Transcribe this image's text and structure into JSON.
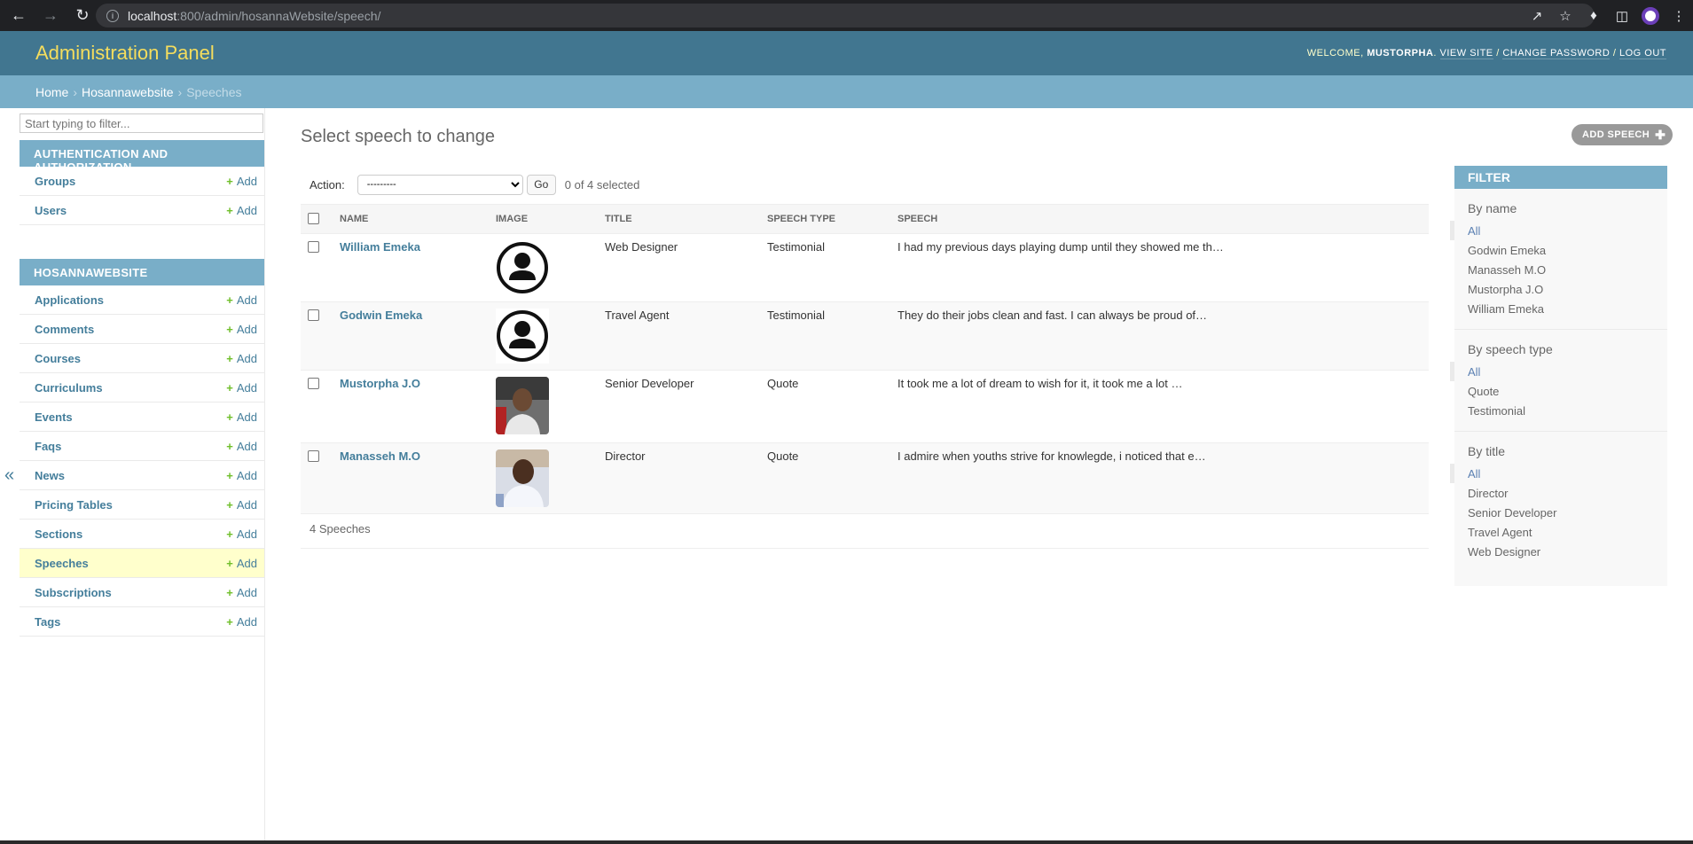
{
  "browser": {
    "url_host": "localhost",
    "url_rest": ":800/admin/hosannaWebsite/speech/"
  },
  "header": {
    "branding": "Administration Panel",
    "welcome": "Welcome,",
    "username": "Mustorpha",
    "view_site": "View site",
    "change_password": "Change password",
    "log_out": "Log out"
  },
  "breadcrumbs": {
    "home": "Home",
    "app": "Hosannawebsite",
    "current": "Speeches"
  },
  "sidebar": {
    "filter_placeholder": "Start typing to filter...",
    "add_label": "Add",
    "auth_caption": "Authentication and Authorization",
    "auth_items": [
      {
        "label": "Groups"
      },
      {
        "label": "Users"
      }
    ],
    "app_caption": "Hosannawebsite",
    "app_items": [
      {
        "label": "Applications"
      },
      {
        "label": "Comments"
      },
      {
        "label": "Courses"
      },
      {
        "label": "Curriculums"
      },
      {
        "label": "Events"
      },
      {
        "label": "Faqs"
      },
      {
        "label": "News"
      },
      {
        "label": "Pricing Tables"
      },
      {
        "label": "Sections"
      },
      {
        "label": "Speeches"
      },
      {
        "label": "Subscriptions"
      },
      {
        "label": "Tags"
      }
    ],
    "collapse_glyph": "«"
  },
  "content": {
    "title": "Select speech to change",
    "add_button": "Add Speech",
    "action_label": "Action:",
    "action_selected": "---------",
    "go": "Go",
    "counter": "0 of 4 selected",
    "columns": [
      "Name",
      "Image",
      "Title",
      "Speech type",
      "Speech"
    ],
    "rows": [
      {
        "name": "William Emeka",
        "image": "avatar-placeholder",
        "title": "Web Designer",
        "type": "Testimonial",
        "speech": "I had my previous days playing dump until they showed me th…"
      },
      {
        "name": "Godwin Emeka",
        "image": "avatar-placeholder",
        "title": "Travel Agent",
        "type": "Testimonial",
        "speech": "They do their jobs clean and fast. I can always be proud of…"
      },
      {
        "name": "Mustorpha J.O",
        "image": "photo",
        "title": "Senior Developer",
        "type": "Quote",
        "speech": "It took me a lot of dream to wish for it, it took me a lot …"
      },
      {
        "name": "Manasseh M.O",
        "image": "photo",
        "title": "Director",
        "type": "Quote",
        "speech": "I admire when youths strive for knowlegde, i noticed that e…"
      }
    ],
    "paginator": "4 Speeches"
  },
  "filter": {
    "title": "Filter",
    "groups": [
      {
        "heading": "By name",
        "options": [
          "All",
          "Godwin Emeka",
          "Manasseh M.O",
          "Mustorpha J.O",
          "William Emeka"
        ]
      },
      {
        "heading": "By speech type",
        "options": [
          "All",
          "Quote",
          "Testimonial"
        ]
      },
      {
        "heading": "By title",
        "options": [
          "All",
          "Director",
          "Senior Developer",
          "Travel Agent",
          "Web Designer"
        ]
      }
    ]
  },
  "colors": {
    "header": "#417690",
    "breadcrumb": "#79aec8",
    "branding": "#f5dd5d",
    "link": "#447e9b",
    "add_green": "#70bf2b",
    "current_row": "#ffffcc"
  }
}
